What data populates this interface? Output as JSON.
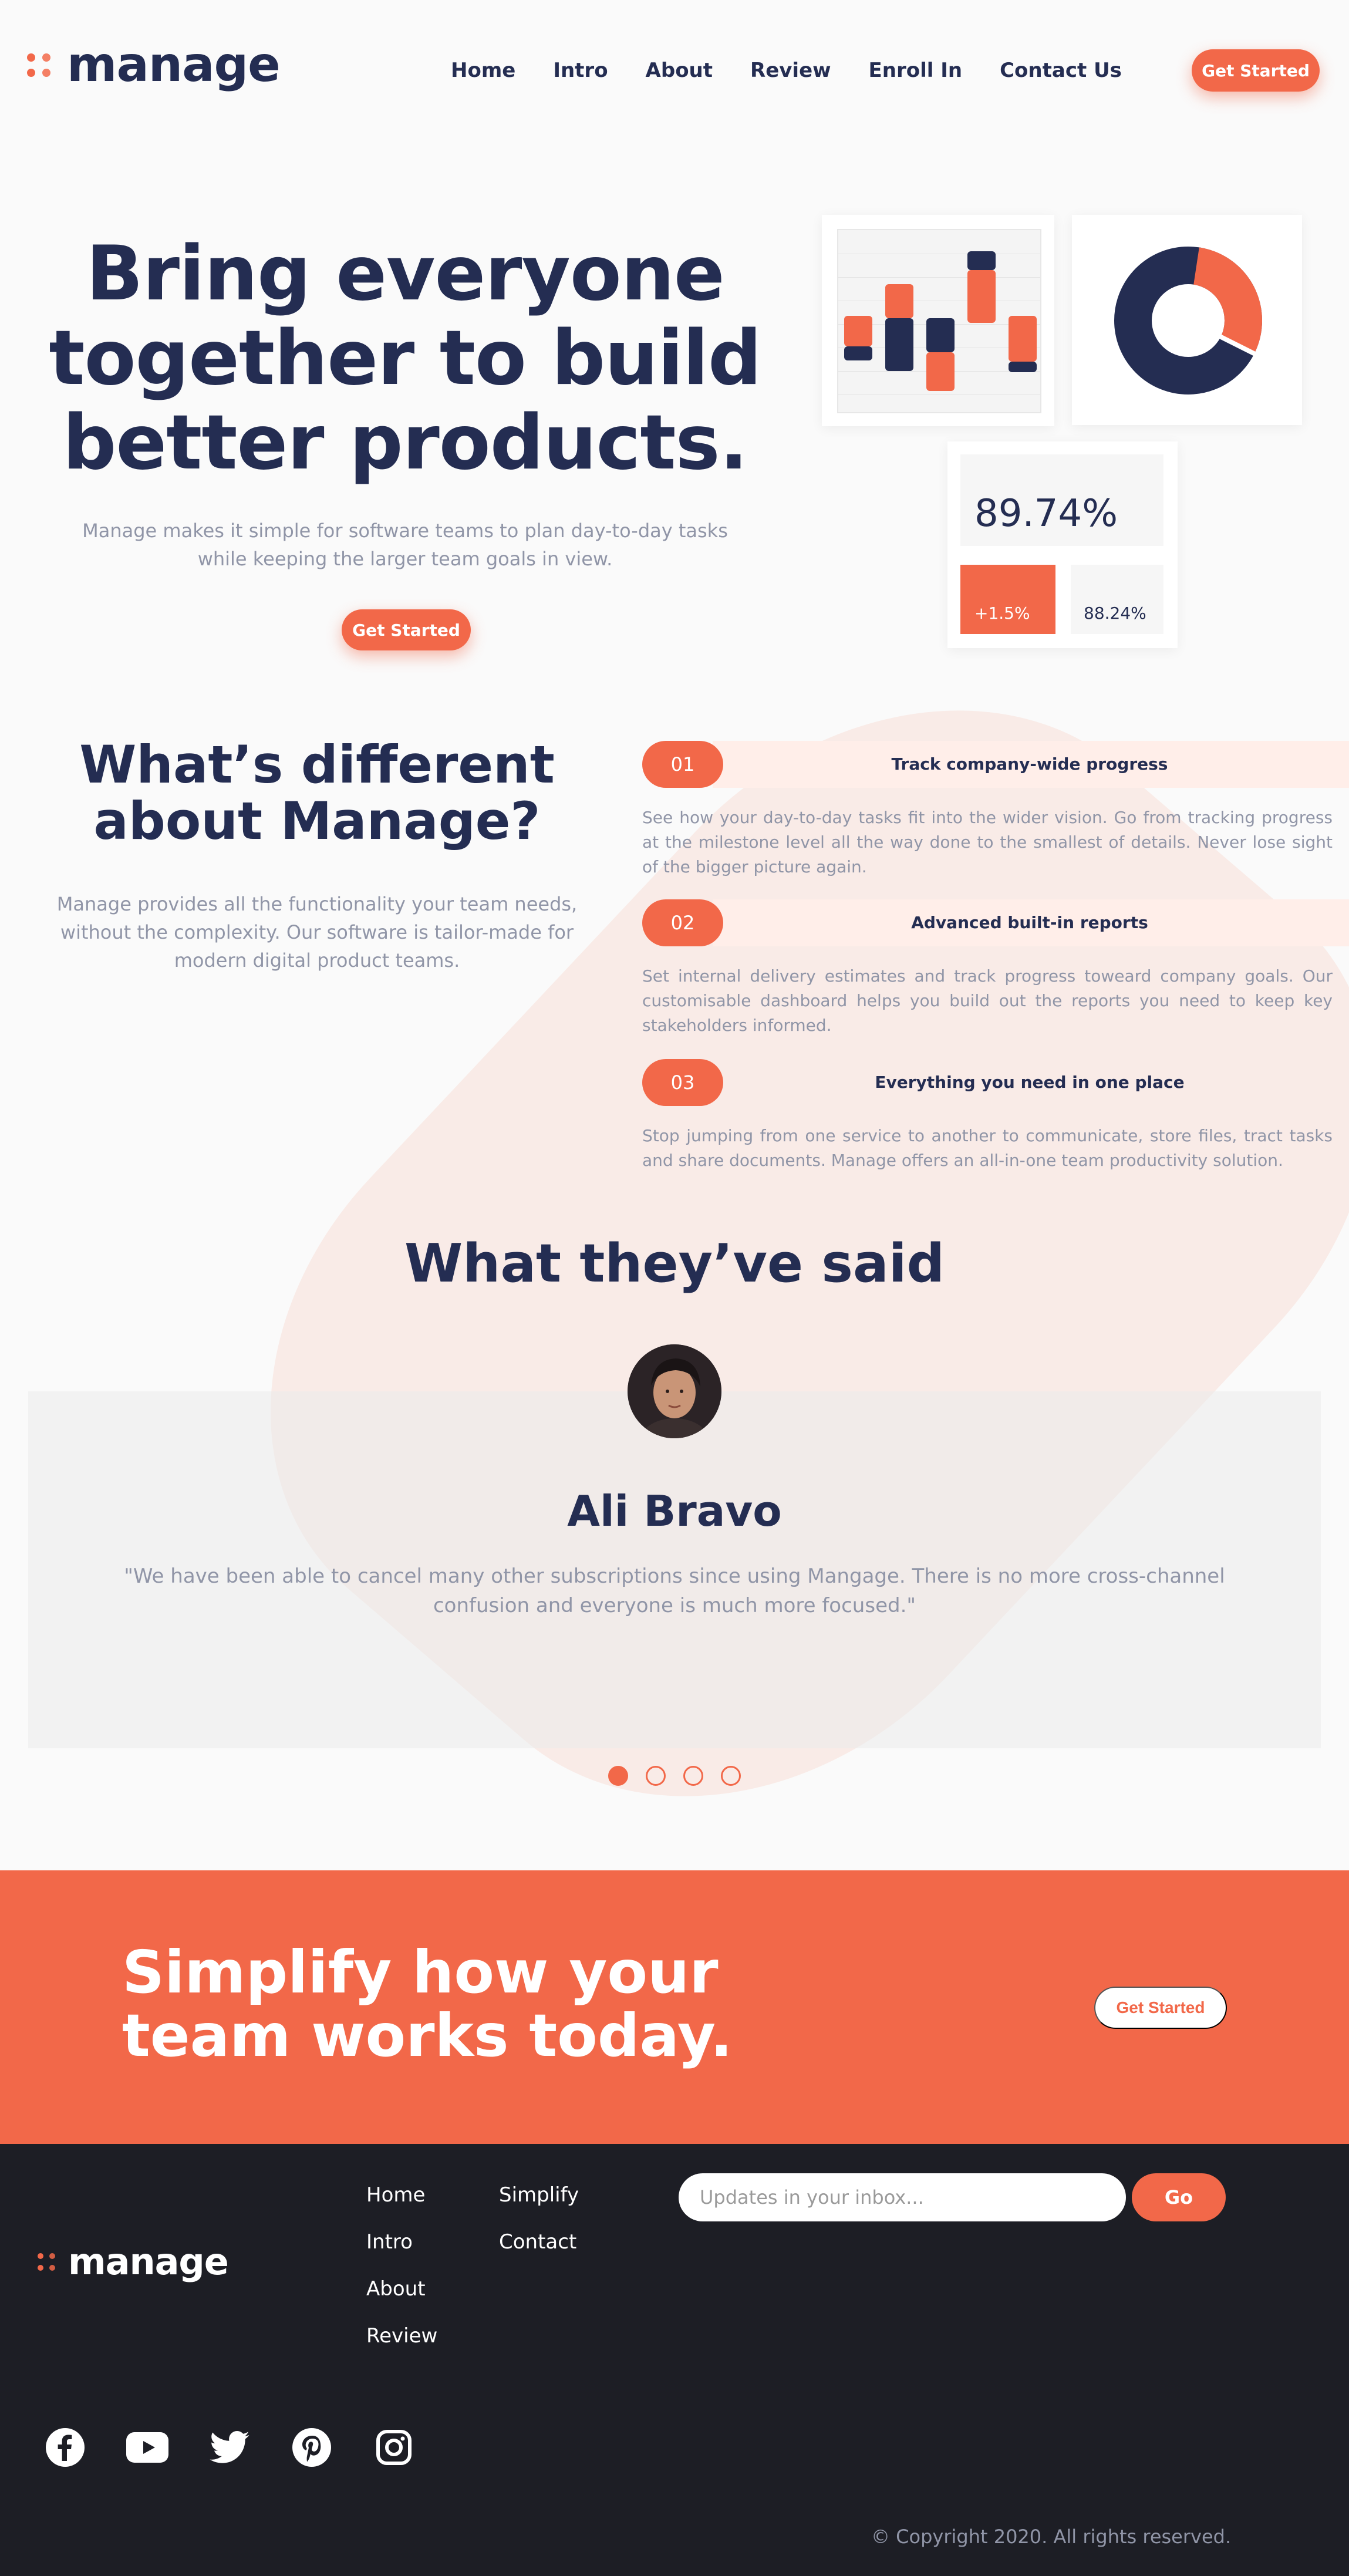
{
  "brand": {
    "name": "manage",
    "accent": "#f26849",
    "dark": "#242d52",
    "footer_bg": "#1d1e25"
  },
  "nav": {
    "links": [
      "Home",
      "Intro",
      "About",
      "Review",
      "Enroll In",
      "Contact Us"
    ],
    "cta": "Get Started"
  },
  "hero": {
    "title": "Bring everyone together to build better products.",
    "subtitle": "Manage makes it simple for software teams to plan day-to-day tasks while keeping the larger team goals in view.",
    "cta": "Get Started",
    "stats": {
      "main": "89.74%",
      "change": "+1.5%",
      "secondary": "88.24%"
    },
    "donut_fill_fraction": 0.3
  },
  "different": {
    "title": "What’s different about Manage?",
    "subtitle": "Manage provides all the functionality your team needs, without the complexity. Our software is tailor-made for modern digital product teams.",
    "features": [
      {
        "num": "01",
        "name": "Track company-wide progress",
        "desc": "See how your day-to-day tasks fit into the wider vision. Go from tracking progress at the milestone level all the way done to the smallest of details. Never lose sight of the bigger picture again."
      },
      {
        "num": "02",
        "name": "Advanced built-in reports",
        "desc": "Set internal delivery estimates and track progress toweard company goals. Our customisable dashboard helps you build out the reports you need to keep key stakeholders informed."
      },
      {
        "num": "03",
        "name": "Everything you need in one place",
        "desc": "Stop jumping from one service to another to communicate, store files, tract tasks and share documents. Manage offers an all-in-one team productivity solution."
      }
    ]
  },
  "testimonials": {
    "title": "What they’ve said",
    "name": "Ali Bravo",
    "quote": "\"We have been able to cancel many other subscriptions since using Mangage. There is no more cross-channel confusion and everyone is much more focused.\"",
    "active_slide": 1,
    "slide_count": 4
  },
  "cta_band": {
    "title": "Simplify how your team works today.",
    "button": "Get Started"
  },
  "footer": {
    "col1": [
      "Home",
      "Intro",
      "About",
      "Review"
    ],
    "col2": [
      "Simplify",
      "Contact"
    ],
    "newsletter_placeholder": "Updates in your inbox...",
    "go": "Go",
    "socials": [
      "facebook-icon",
      "youtube-icon",
      "twitter-icon",
      "pinterest-icon",
      "instagram-icon"
    ],
    "copyright": "© Copyright 2020. All rights reserved."
  }
}
